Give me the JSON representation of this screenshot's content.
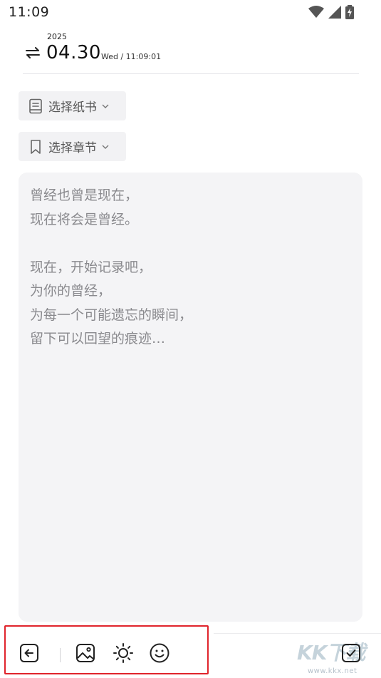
{
  "status_bar": {
    "time": "11:09",
    "icons": [
      "wifi-icon",
      "cellular-signal-icon",
      "battery-charging-icon"
    ]
  },
  "header": {
    "year": "2025",
    "date": "04.30",
    "weekday_time": "Wed / 11:09:01",
    "swap_icon": "swap-arrows-icon"
  },
  "selectors": {
    "notebook_label": "选择纸书",
    "chapter_label": "选择章节"
  },
  "editor": {
    "placeholder_lines": [
      "曾经也曾是现在，",
      "现在将会是曾经。",
      "",
      "现在，开始记录吧，",
      "为你的曾经，",
      "为每一个可能遗忘的瞬间，",
      "留下可以回望的痕迹…"
    ]
  },
  "toolbar": {
    "items": [
      "back-icon",
      "image-icon",
      "weather-sun-icon",
      "mood-smile-icon",
      "done-check-icon"
    ]
  },
  "watermark": {
    "logo": "KK下载",
    "url": "www.kkx.net"
  },
  "colors": {
    "highlight": "#e0242c",
    "editor_bg": "#f4f4f6",
    "chip_bg": "#f2f2f4",
    "placeholder_text": "#8a8a8e"
  }
}
